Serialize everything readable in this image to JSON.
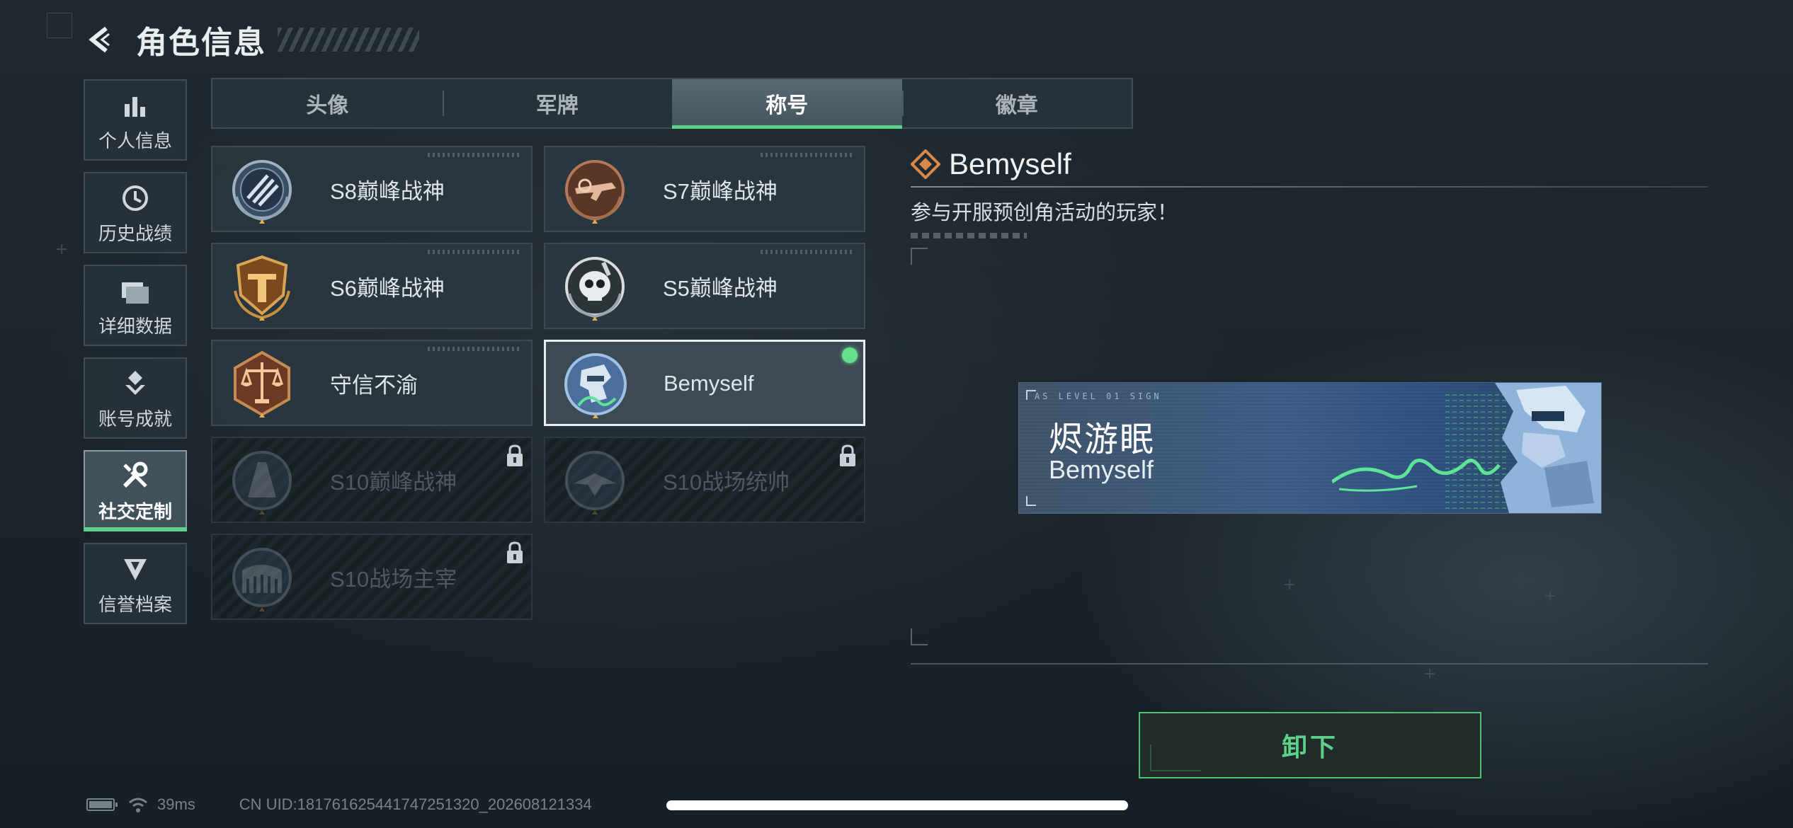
{
  "header": {
    "title": "角色信息",
    "back_icon": "back-arrow-icon"
  },
  "sidenav": {
    "items": [
      {
        "label": "个人信息",
        "icon": "bar-chart-icon",
        "active": false
      },
      {
        "label": "历史战绩",
        "icon": "clock-icon",
        "active": false
      },
      {
        "label": "详细数据",
        "icon": "folder-icon",
        "active": false
      },
      {
        "label": "账号成就",
        "icon": "medal-icon",
        "active": false
      },
      {
        "label": "社交定制",
        "icon": "tools-icon",
        "active": true
      },
      {
        "label": "信誉档案",
        "icon": "shield-badge-icon",
        "active": false
      }
    ]
  },
  "tabs": [
    {
      "label": "头像",
      "active": false
    },
    {
      "label": "军牌",
      "active": false
    },
    {
      "label": "称号",
      "active": true
    },
    {
      "label": "徽章",
      "active": false
    }
  ],
  "titles": [
    {
      "name": "S8巅峰战神",
      "emblem": "blue-wings-emblem-icon",
      "locked": false,
      "selected": false
    },
    {
      "name": "S7巅峰战神",
      "emblem": "bronze-gun-emblem-icon",
      "locked": false,
      "selected": false
    },
    {
      "name": "S6巅峰战神",
      "emblem": "gold-shield-emblem-icon",
      "locked": false,
      "selected": false
    },
    {
      "name": "S5巅峰战神",
      "emblem": "skull-emblem-icon",
      "locked": false,
      "selected": false
    },
    {
      "name": "守信不渝",
      "emblem": "scales-emblem-icon",
      "locked": false,
      "selected": false
    },
    {
      "name": "Bemyself",
      "emblem": "soldier-signature-emblem-icon",
      "locked": false,
      "selected": true,
      "equipped": true
    },
    {
      "name": "S10巅峰战神",
      "emblem": "tower-emblem-icon",
      "locked": true,
      "selected": false
    },
    {
      "name": "S10战场统帅",
      "emblem": "jet-emblem-icon",
      "locked": true,
      "selected": false
    },
    {
      "name": "S10战场主宰",
      "emblem": "colosseum-emblem-icon",
      "locked": true,
      "selected": false
    }
  ],
  "detail": {
    "title": "Bemyself",
    "title_icon": "diamond-rank-icon",
    "description": "参与开服预创角活动的玩家！",
    "nameplate": {
      "player_name": "烬游眠",
      "title": "Bemyself",
      "code_text": "AS LEVEL 01 SIGN"
    },
    "unequip_label": "卸下"
  },
  "status": {
    "ping": "39ms",
    "uid": "CN UID:18176162544174725132​0_202608121334",
    "battery_icon": "battery-icon",
    "wifi_icon": "wifi-icon"
  },
  "colors": {
    "accent": "#5bd18a",
    "background": "#1d262c"
  }
}
